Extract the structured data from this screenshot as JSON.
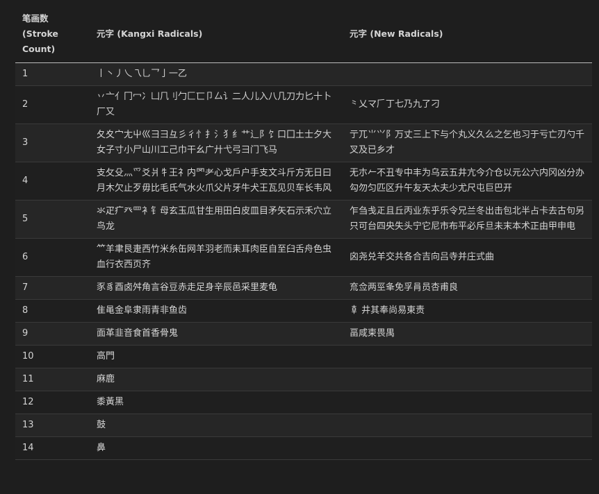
{
  "table": {
    "headers": {
      "strokes": "笔画数 (Stroke Count)",
      "kangxi": "元字 (Kangxi Radicals)",
      "new": "元字 (New Radicals)"
    },
    "rows": [
      {
        "strokes": "1",
        "kangxi": "丨丶丿乀乁乚乛亅一乙",
        "new": ""
      },
      {
        "strokes": "2",
        "kangxi": "丷亠亻冂冖冫凵𠘨刂勹匚匸卩厶讠二人儿入八几刀力匕十卜厂又",
        "new": "⺀乂マ𠂆丁七乃九了刁"
      },
      {
        "strokes": "3",
        "kangxi": "夂夊宀尢屮巛⺕彐彑彡彳忄扌氵犭纟艹辶阝饣口囗土士夕大女子寸小尸山川工己巾干幺广廾弋弓彐门飞马",
        "new": "亍兀⺌⺍阝万丈三上下与个丸义久么之乞也习于亏亡刃勺千叉及已乡才"
      },
      {
        "strokes": "4",
        "kangxi": "支攵殳灬爫爻爿牜王礻内罓耂心戈戶户手支文斗斤方无日曰月木欠止歹毋比毛氏气水火爪父片牙牛犬王瓦见贝车长韦风",
        "new": "无朩𠂉不丑专中丰为乌云五井亢今介仓以元公六内冈凶分办勾勿匀匹区升午友天太夫少尤尺屯巨巴开"
      },
      {
        "strokes": "5",
        "kangxi": "氺疋疒癶罒衤钅母玄玉瓜甘生用田白皮皿目矛矢石示禾穴立鸟龙",
        "new": "乍刍戋𤴓且丘丙业东乎乐令兄兰冬出击包北半占卡去古句另只可台四央失头宁它尼市布平必斥旦未末本术正由甲申电"
      },
      {
        "strokes": "6",
        "kangxi": "⺮羊聿艮疌西竹米糸缶网羊羽老而耒耳肉臣自至臼舌舟色虫血行衣西页齐",
        "new": "囟尧兑羊交共各合吉向吕寺并庄式曲"
      },
      {
        "strokes": "7",
        "kangxi": "豕豸酉卤舛角言谷豆赤走足身辛辰邑采里麦龟",
        "new": "㐬佥两巠夆免孚肙员杏甫良"
      },
      {
        "strokes": "8",
        "kangxi": "隹黾金阜隶雨青非鱼齿",
        "new": "𠦝 井其奉尚易東责"
      },
      {
        "strokes": "9",
        "kangxi": "面革韭音食首香骨鬼",
        "new": "畐咸柬畏禺"
      },
      {
        "strokes": "10",
        "kangxi": "高門",
        "new": ""
      },
      {
        "strokes": "11",
        "kangxi": "麻鹿",
        "new": ""
      },
      {
        "strokes": "12",
        "kangxi": "黍黃黑",
        "new": ""
      },
      {
        "strokes": "13",
        "kangxi": "鼓",
        "new": ""
      },
      {
        "strokes": "14",
        "kangxi": "鼻",
        "new": ""
      }
    ]
  }
}
